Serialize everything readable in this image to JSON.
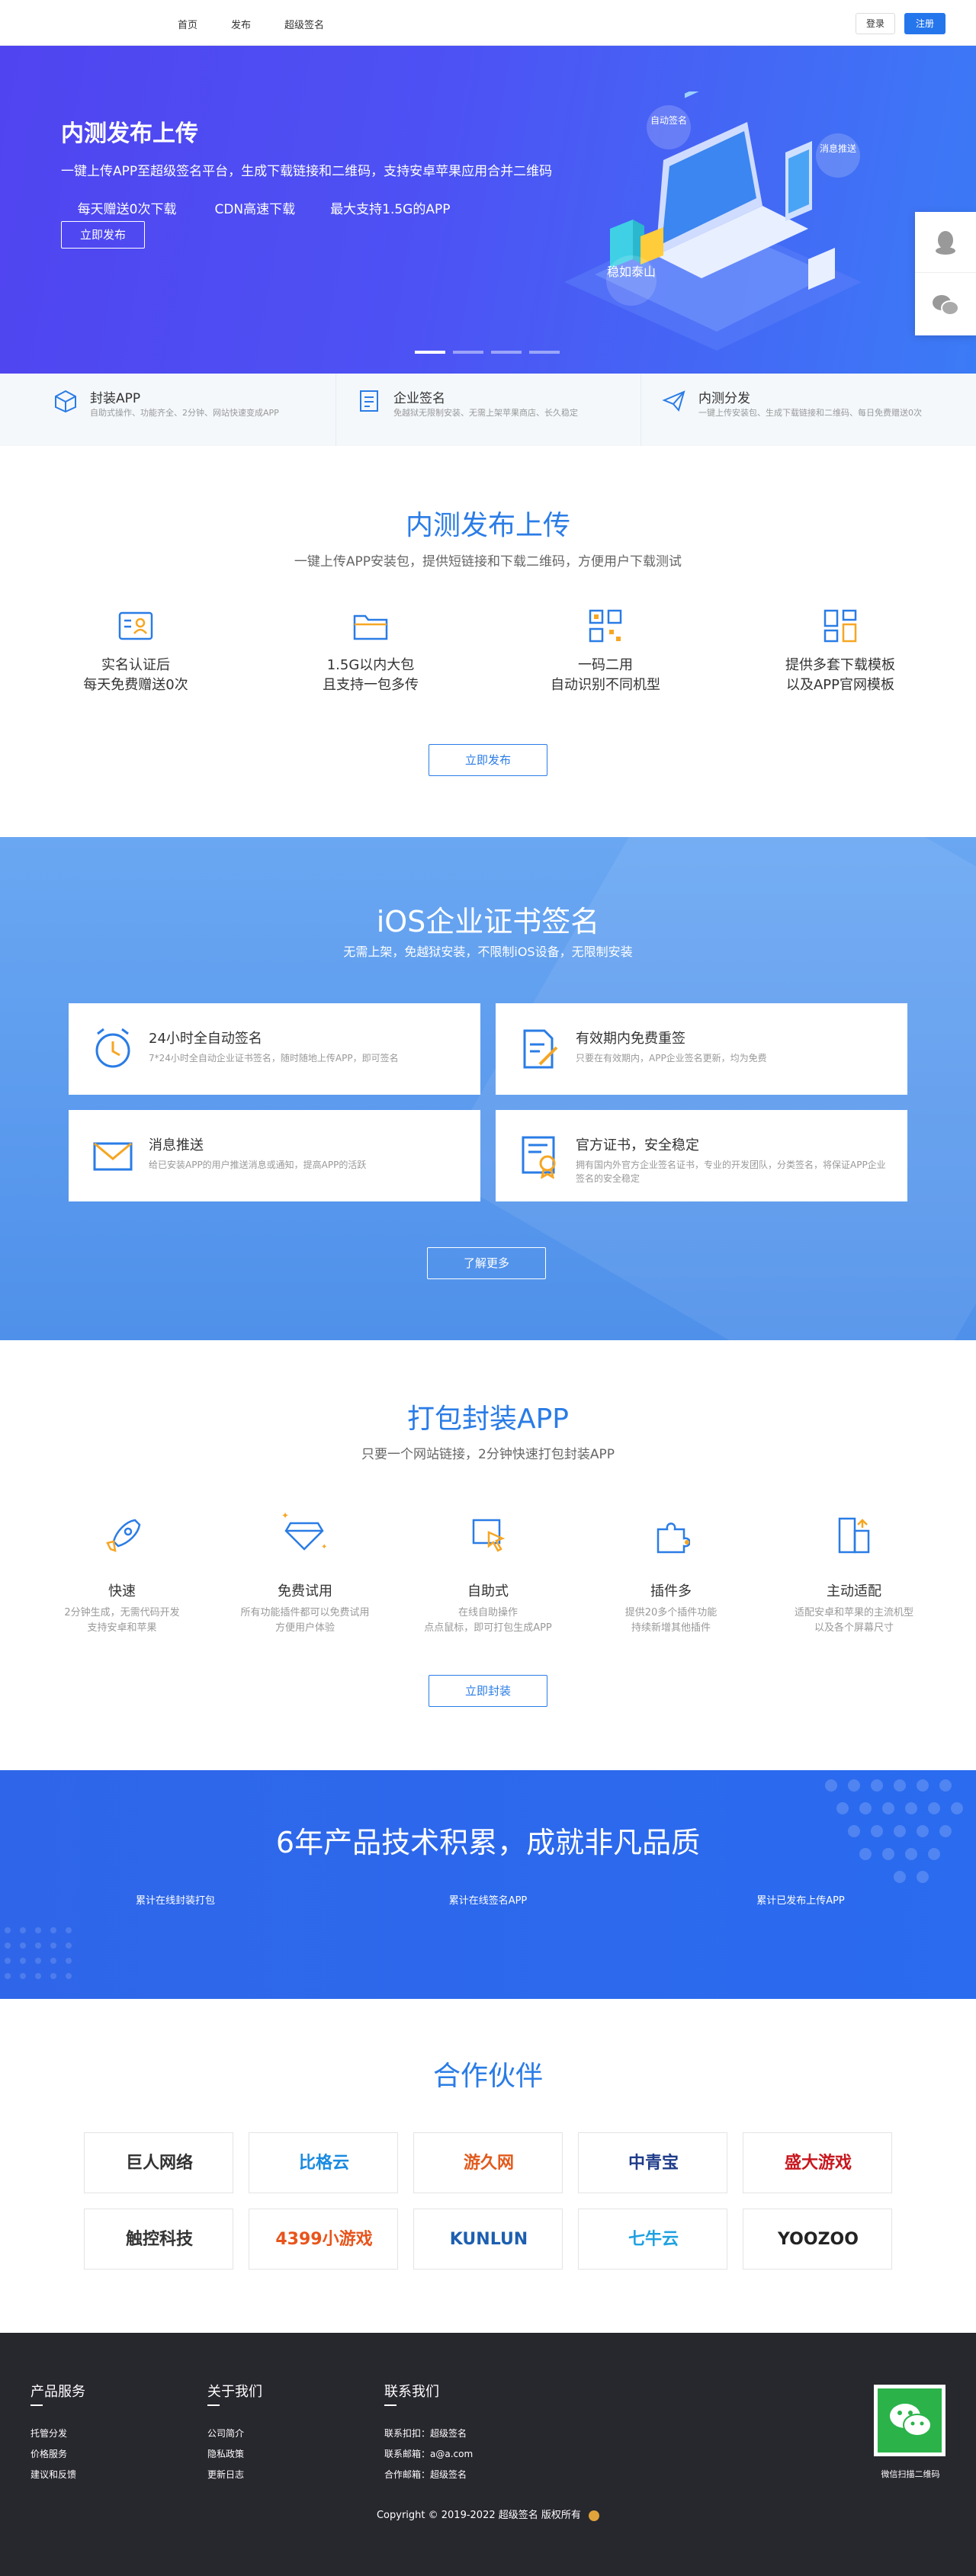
{
  "nav": {
    "items": [
      "首页",
      "发布",
      "超级签名"
    ],
    "login": "登录",
    "register": "注册"
  },
  "hero": {
    "title": "内测发布上传",
    "desc": "一键上传APP至超级签名平台，生成下载链接和二维码，支持安卓苹果应用合并二维码",
    "line2": [
      "每天赠送0次下载",
      "CDN高速下载",
      "最大支持1.5G的APP"
    ],
    "button": "立即发布",
    "bubbles": [
      "自动签名",
      "消息推送",
      "稳如泰山"
    ]
  },
  "strip": [
    {
      "title": "封装APP",
      "sub": "自助式操作、功能齐全、2分钟、网站快速变成APP"
    },
    {
      "title": "企业签名",
      "sub": "免越狱无限制安装、无需上架苹果商店、长久稳定"
    },
    {
      "title": "内测分发",
      "sub": "一键上传安装包、生成下载链接和二维码、每日免费赠送0次"
    }
  ],
  "publish": {
    "title": "内测发布上传",
    "sub": "一键上传APP安装包，提供短链接和下载二维码，方便用户下载测试",
    "features": [
      [
        "实名认证后",
        "每天免费赠送0次"
      ],
      [
        "1.5G以内大包",
        "且支持一包多传"
      ],
      [
        "一码二用",
        "自动识别不同机型"
      ],
      [
        "提供多套下载模板",
        "以及APP官网模板"
      ]
    ],
    "button": "立即发布"
  },
  "ios": {
    "title": "iOS企业证书签名",
    "sub": "无需上架，免越狱安装，不限制iOS设备，无限制安装",
    "cards": [
      {
        "title": "24小时全自动签名",
        "sub": "7*24小时全自动企业证书签名，随时随地上传APP，即可签名"
      },
      {
        "title": "有效期内免费重签",
        "sub": "只要在有效期内，APP企业签名更新，均为免费"
      },
      {
        "title": "消息推送",
        "sub": "给已安装APP的用户推送消息或通知，提高APP的活跃"
      },
      {
        "title": "官方证书，安全稳定",
        "sub": "拥有国内外官方企业签名证书，专业的开发团队，分类签名，将保证APP企业签名的安全稳定"
      }
    ],
    "button": "了解更多"
  },
  "pack": {
    "title": "打包封装APP",
    "sub": "只要一个网站链接，2分钟快速打包封装APP",
    "items": [
      {
        "label": "快速",
        "desc": [
          "2分钟生成，无需代码开发",
          "支持安卓和苹果"
        ]
      },
      {
        "label": "免费试用",
        "desc": [
          "所有功能插件都可以免费试用",
          "方便用户体验"
        ]
      },
      {
        "label": "自助式",
        "desc": [
          "在线自助操作",
          "点点鼠标，即可打包生成APP"
        ]
      },
      {
        "label": "插件多",
        "desc": [
          "提供20多个插件功能",
          "持续新增其他插件"
        ]
      },
      {
        "label": "主动适配",
        "desc": [
          "适配安卓和苹果的主流机型",
          "以及各个屏幕尺寸"
        ]
      }
    ],
    "button": "立即封装"
  },
  "stats": {
    "title": "6年产品技术积累，成就非凡品质",
    "items": [
      "累计在线封装打包",
      "累计在线签名APP",
      "累计已发布上传APP"
    ]
  },
  "partners": {
    "title": "合作伙伴",
    "logos": [
      {
        "name": "巨人网络",
        "color": "#333333"
      },
      {
        "name": "比格云",
        "color": "#1a8be0"
      },
      {
        "name": "游久网",
        "color": "#e25a1c"
      },
      {
        "name": "中青宝",
        "color": "#1f3c8a"
      },
      {
        "name": "盛大游戏",
        "color": "#c8171e"
      },
      {
        "name": "触控科技",
        "color": "#333333"
      },
      {
        "name": "4399小游戏",
        "color": "#e8541b"
      },
      {
        "name": "KUNLUN",
        "color": "#1d5fb0"
      },
      {
        "name": "七牛云",
        "color": "#1fa1e0"
      },
      {
        "name": "YOOZOO",
        "color": "#222222"
      }
    ]
  },
  "footer": {
    "cols": [
      {
        "title": "产品服务",
        "links": [
          "托管分发",
          "价格服务",
          "建议和反馈"
        ]
      },
      {
        "title": "关于我们",
        "links": [
          "公司简介",
          "隐私政策",
          "更新日志"
        ]
      },
      {
        "title": "联系我们",
        "links": [
          "联系扣扣：超级签名",
          "联系邮箱：a@a.com",
          "合作邮箱：超级签名"
        ]
      }
    ],
    "qr_label": "微信扫描二维码",
    "copyright": "Copyright © 2019-2022 超级签名 版权所有"
  },
  "colors": {
    "primary": "#2a7ce6",
    "hero_start": "#5044f0",
    "hero_end": "#3b7bf6",
    "footer": "#27272e"
  }
}
